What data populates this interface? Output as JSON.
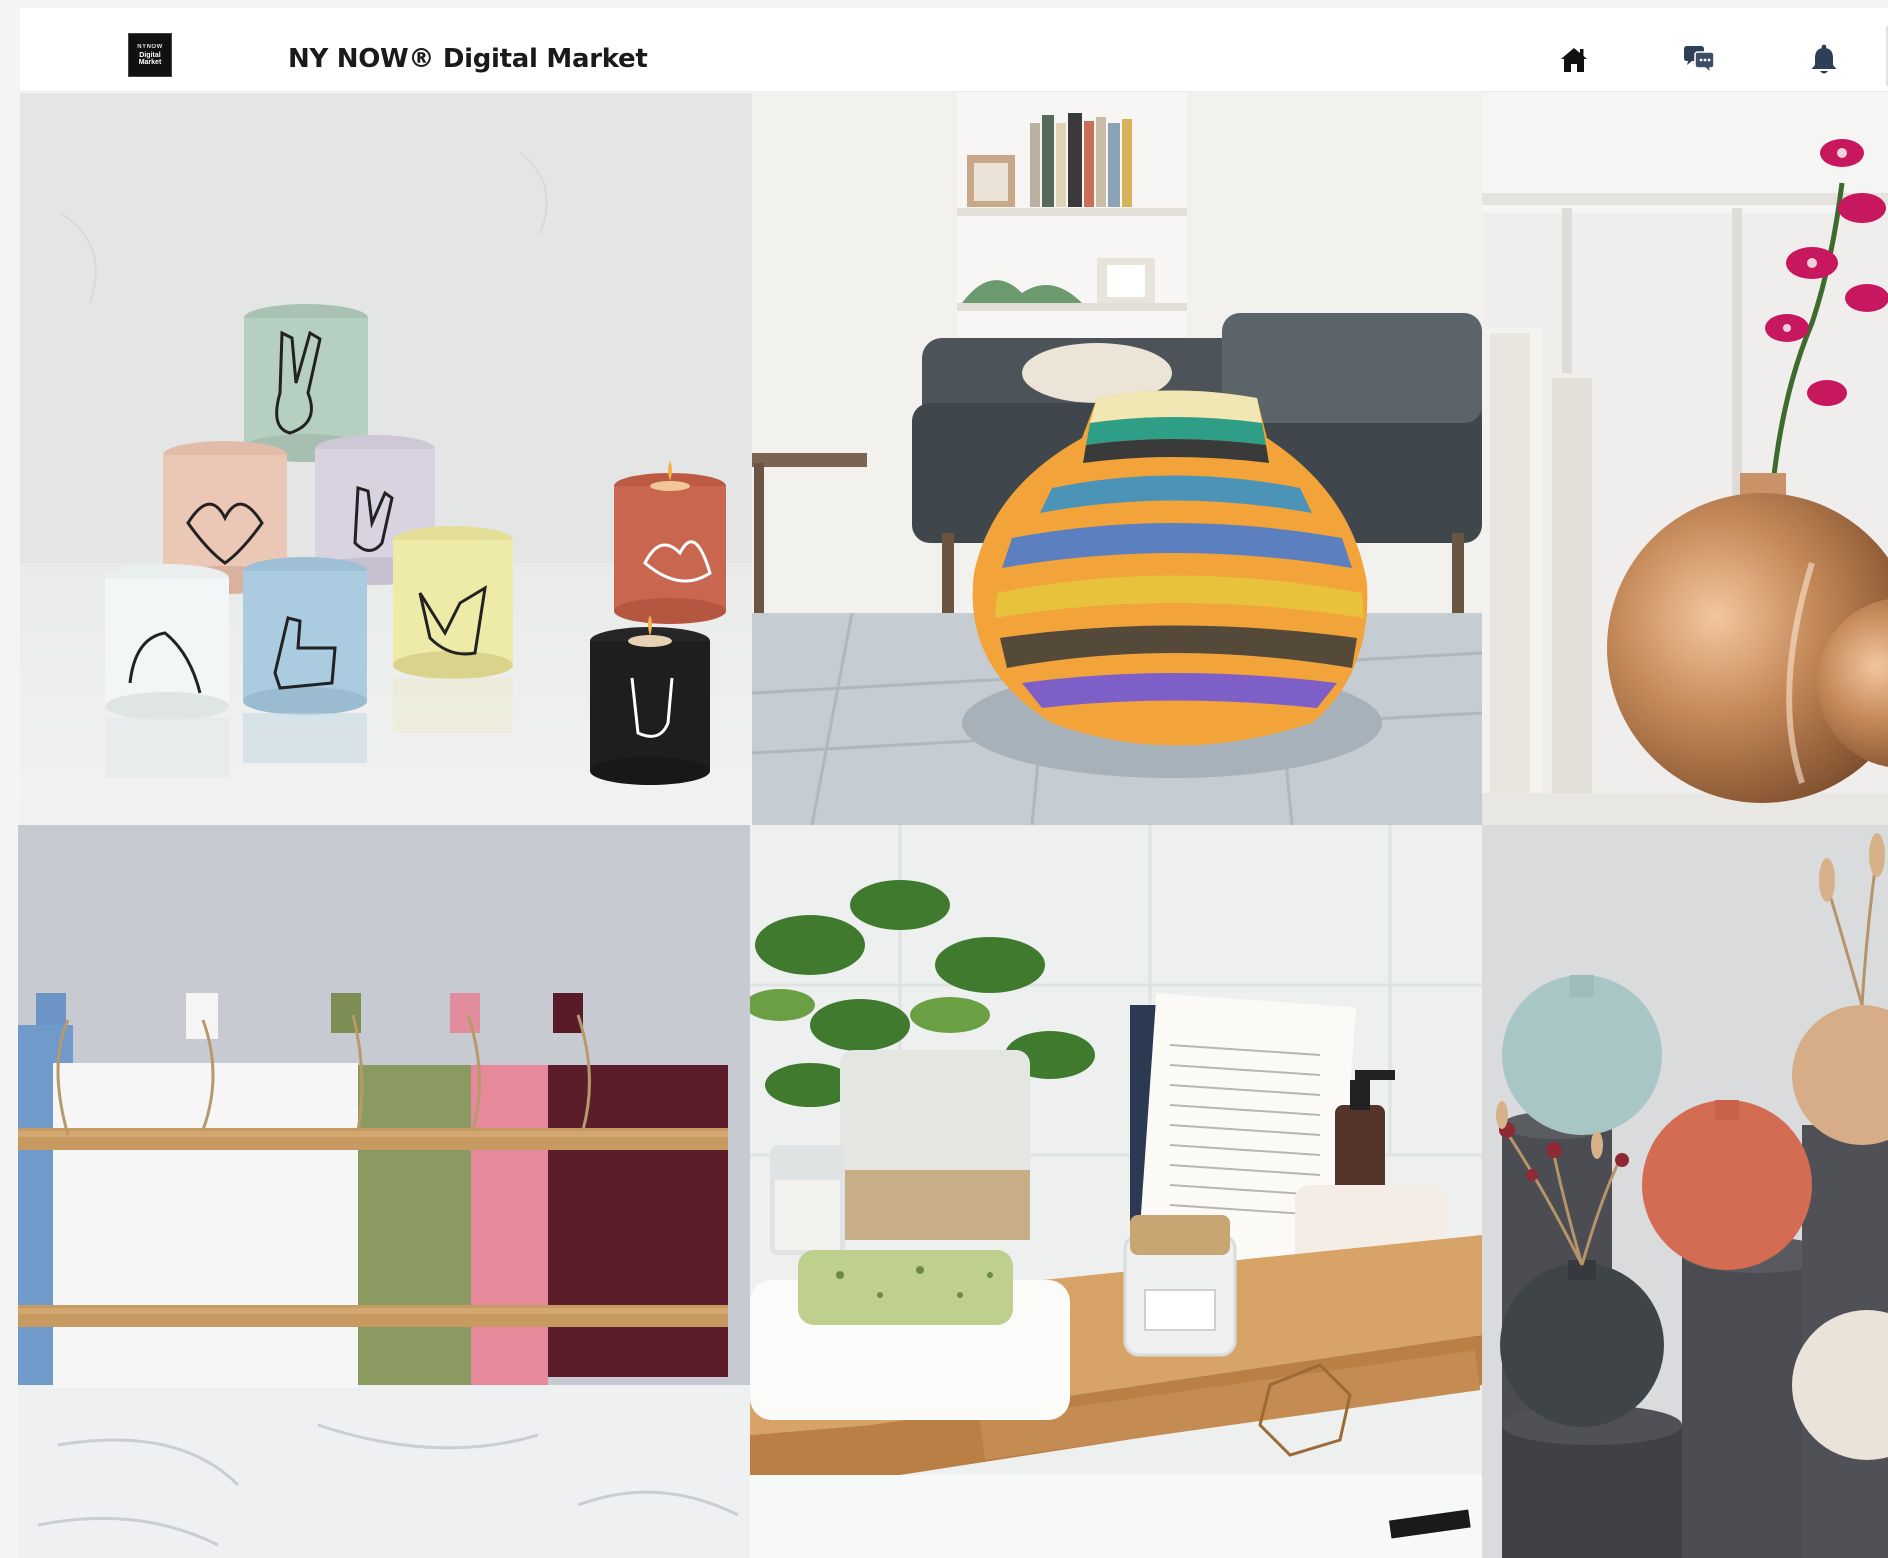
{
  "header": {
    "logo_lines": [
      "NYNOW",
      "Digital",
      "Market"
    ],
    "title": "NY NOW® Digital Market",
    "icons": [
      "home-icon",
      "chat-icon",
      "bell-icon"
    ]
  },
  "colors": {
    "header_bg": "#ffffff",
    "icon_dark": "#111111",
    "icon_chat": "#2f3f55",
    "icon_bell": "#2f3f55"
  },
  "products": [
    {
      "position": 1,
      "subject": "hand-gesture-candles"
    },
    {
      "position": 2,
      "subject": "woven-basket"
    },
    {
      "position": 3,
      "subject": "copper-vase"
    },
    {
      "position": 4,
      "subject": "cutting-boards"
    },
    {
      "position": 5,
      "subject": "bamboo-bath-tray"
    },
    {
      "position": 6,
      "subject": "ceramic-bud-vases"
    }
  ]
}
